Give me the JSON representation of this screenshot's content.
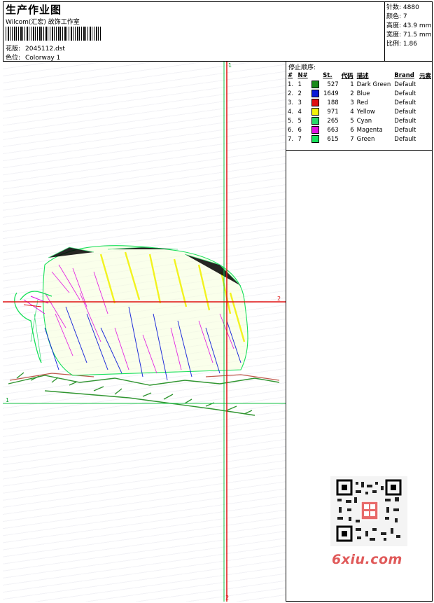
{
  "header": {
    "title": "生产作业图",
    "company": "Wilcom(汇宏) 故饰工作室",
    "design_label": "花版:",
    "design_value": "2045112.dst",
    "colorway_label": "色位:",
    "colorway_value": "Colorway 1"
  },
  "stats": [
    {
      "label": "针数:",
      "value": "4880"
    },
    {
      "label": "颜色:",
      "value": "7"
    },
    {
      "label": "高度:",
      "value": "43.9 mm"
    },
    {
      "label": "宽度:",
      "value": "71.5 mm"
    },
    {
      "label": "比例:",
      "value": "1.86"
    }
  ],
  "canvas": {
    "marker_top": "1",
    "marker_bottom": "2",
    "marker_left": "1",
    "marker_right": "2"
  },
  "stop_sequence": {
    "title": "停止顺序:",
    "columns": [
      "#",
      "N#",
      "St.",
      "代码",
      "描述",
      "Brand",
      "元素"
    ],
    "rows": [
      {
        "idx": "1.",
        "no": "1",
        "color": "#1a8a1a",
        "st": "527",
        "code": "1",
        "desc": "Dark Green",
        "brand": "Default"
      },
      {
        "idx": "2.",
        "no": "2",
        "color": "#0a1ad8",
        "st": "1649",
        "code": "2",
        "desc": "Blue",
        "brand": "Default"
      },
      {
        "idx": "3.",
        "no": "3",
        "color": "#e01010",
        "st": "188",
        "code": "3",
        "desc": "Red",
        "brand": "Default"
      },
      {
        "idx": "4.",
        "no": "4",
        "color": "#f2f20a",
        "st": "971",
        "code": "4",
        "desc": "Yellow",
        "brand": "Default"
      },
      {
        "idx": "5.",
        "no": "5",
        "color": "#28d86a",
        "st": "265",
        "code": "5",
        "desc": "Cyan",
        "brand": "Default"
      },
      {
        "idx": "6.",
        "no": "6",
        "color": "#e010e0",
        "st": "663",
        "code": "6",
        "desc": "Magenta",
        "brand": "Default"
      },
      {
        "idx": "7.",
        "no": "7",
        "color": "#18e05a",
        "st": "615",
        "code": "7",
        "desc": "Green",
        "brand": "Default"
      }
    ]
  },
  "watermark": "6xiu.com"
}
